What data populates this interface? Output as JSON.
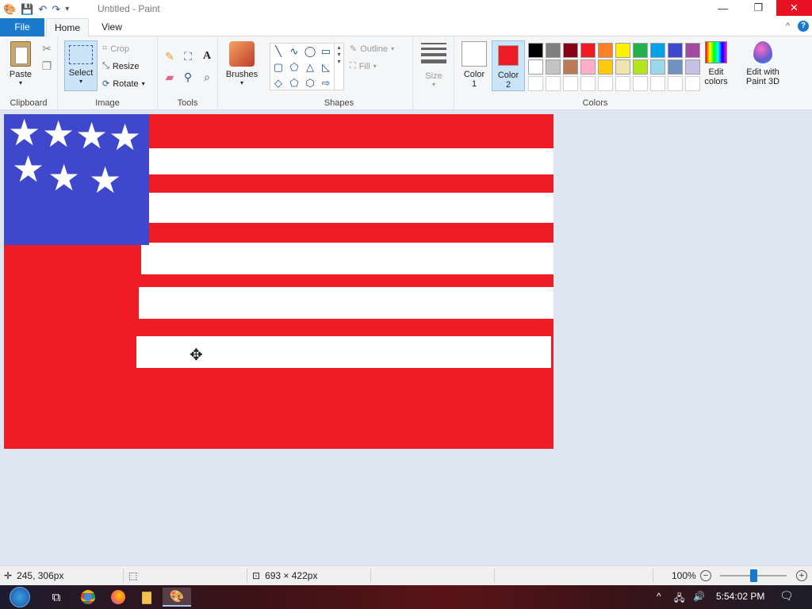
{
  "window": {
    "title": "Untitled - Paint",
    "minimize_label": "—",
    "restore_label": "❐",
    "close_label": "✕"
  },
  "quick_access": {
    "paint_icon": "paint-icon",
    "save_icon": "save-icon",
    "undo_icon": "undo-icon",
    "redo_icon": "redo-icon",
    "customize_icon": "chevron-down-icon"
  },
  "tabs": {
    "file": "File",
    "home": "Home",
    "view": "View",
    "collapse": "^",
    "help": "?"
  },
  "ribbon": {
    "clipboard": {
      "label": "Clipboard",
      "paste": "Paste",
      "cut_icon": "scissors-icon",
      "copy_icon": "copy-icon"
    },
    "image": {
      "label": "Image",
      "select": "Select",
      "crop": "Crop",
      "resize": "Resize",
      "rotate": "Rotate"
    },
    "tools": {
      "label": "Tools",
      "pencil_icon": "pencil-icon",
      "fill_icon": "bucket-icon",
      "text_icon": "A",
      "eraser_icon": "eraser-icon",
      "picker_icon": "color-picker-icon",
      "magnifier_icon": "magnifier-icon"
    },
    "brushes": {
      "label": "Brushes"
    },
    "shapes": {
      "label": "Shapes",
      "outline": "Outline",
      "fill": "Fill"
    },
    "size": {
      "label": "Size"
    },
    "colors": {
      "label": "Colors",
      "color1_label": "Color\n1",
      "color1_line1": "Color",
      "color1_line2": "1",
      "color2_line1": "Color",
      "color2_line2": "2",
      "color1_value": "#ffffff",
      "color2_value": "#ee1c24",
      "edit_colors_line1": "Edit",
      "edit_colors_line2": "colors",
      "paint3d_line1": "Edit with",
      "paint3d_line2": "Paint 3D",
      "palette_row1": [
        "#000000",
        "#7f7f7f",
        "#880015",
        "#ed1c24",
        "#ff7f27",
        "#fff200",
        "#22b14c",
        "#00a2e8",
        "#3f48cc",
        "#a349a4"
      ],
      "palette_row2": [
        "#ffffff",
        "#c3c3c3",
        "#b97a57",
        "#ffaec9",
        "#ffc90e",
        "#efe4b0",
        "#b5e61d",
        "#99d9ea",
        "#7092be",
        "#c8bfe7"
      ]
    }
  },
  "status": {
    "cursor_pos": "245, 306px",
    "canvas_size": "693 × 422px",
    "zoom": "100%",
    "zoom_out": "−",
    "zoom_in": "+"
  },
  "taskbar": {
    "time": "5:54:02 PM"
  }
}
